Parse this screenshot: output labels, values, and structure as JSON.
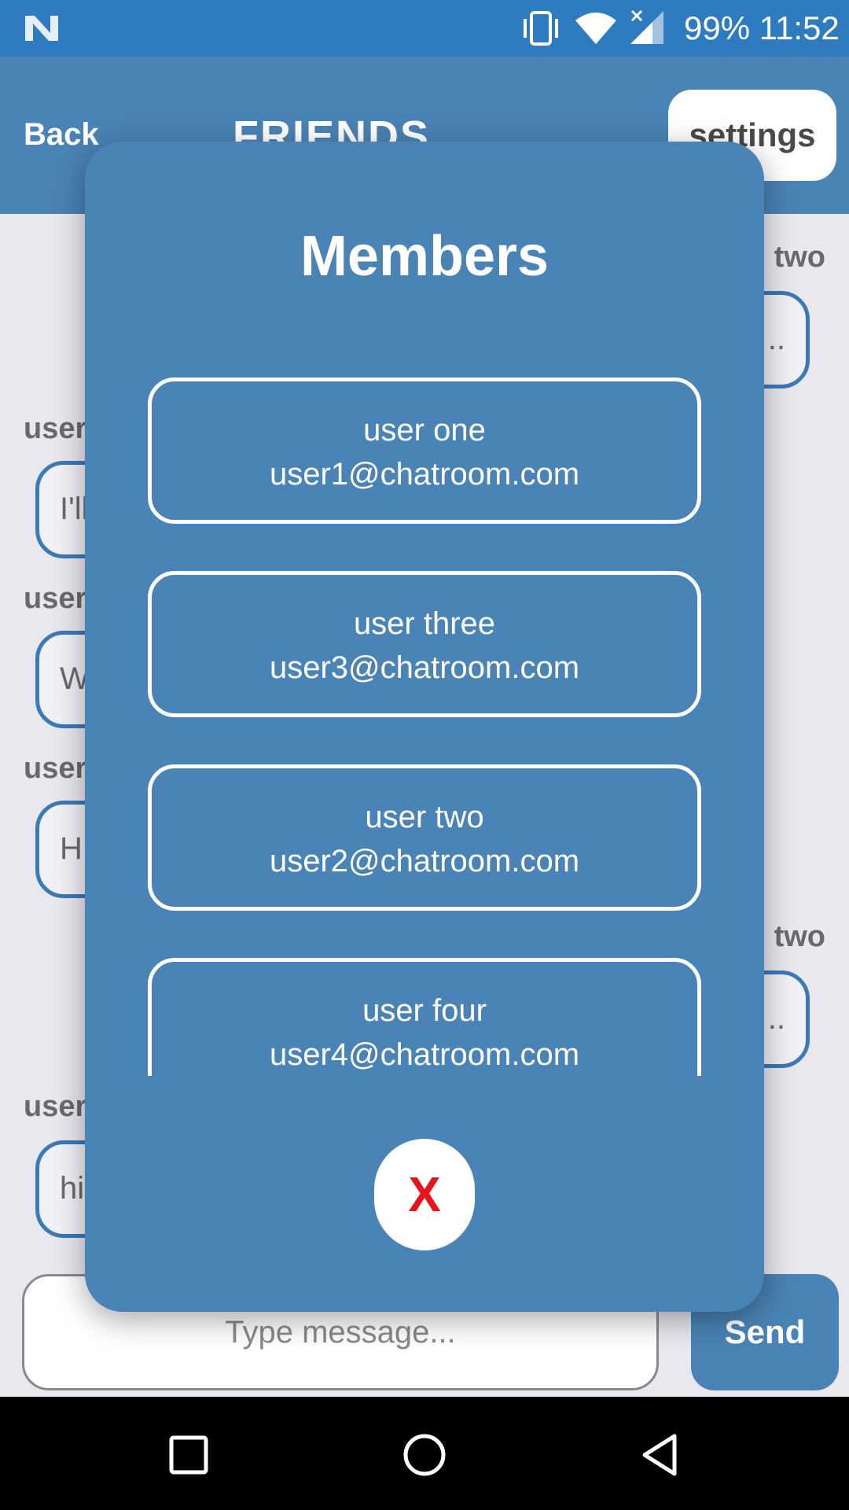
{
  "status_bar": {
    "battery": "99%",
    "time": "11:52",
    "icons": [
      "n-logo-icon",
      "vibrate-icon",
      "wifi-icon",
      "signal-icon"
    ]
  },
  "header": {
    "back_label": "Back",
    "title": "FRIENDS",
    "settings_label": "settings"
  },
  "chat": {
    "messages": [
      {
        "sender": "two",
        "text": "..",
        "side": "right"
      },
      {
        "sender": "user",
        "text": "I'll",
        "side": "left"
      },
      {
        "sender": "user",
        "text": "W",
        "side": "left"
      },
      {
        "sender": "user",
        "text": "H",
        "side": "left"
      },
      {
        "sender": "two",
        "text": "..",
        "side": "right"
      },
      {
        "sender": "user",
        "text": "hi",
        "side": "left"
      }
    ]
  },
  "composer": {
    "placeholder": "Type message...",
    "send_label": "Send"
  },
  "modal": {
    "title": "Members",
    "members": [
      {
        "name": "user one",
        "email": "user1@chatroom.com"
      },
      {
        "name": "user three",
        "email": "user3@chatroom.com"
      },
      {
        "name": "user two",
        "email": "user2@chatroom.com"
      },
      {
        "name": "user four",
        "email": "user4@chatroom.com"
      }
    ],
    "close_label": "X"
  },
  "colors": {
    "status_bar": "#2f7bbf",
    "primary": "#4a83b5",
    "bubble_border": "#3b79b9",
    "close_x": "#e8141c"
  }
}
